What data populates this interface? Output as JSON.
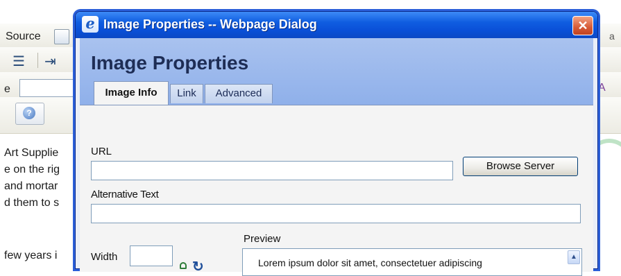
{
  "editor": {
    "source_label": "Source",
    "field_prefix": "e",
    "background_lines": [
      "Art Supplie",
      "e on the rig",
      "and mortar",
      "d them to s",
      "few years i"
    ]
  },
  "dialog": {
    "title": "Image Properties -- Webpage Dialog",
    "heading": "Image Properties",
    "close_glyph": "✕",
    "tabs": [
      {
        "label": "Image Info",
        "active": true
      },
      {
        "label": "Link",
        "active": false
      },
      {
        "label": "Advanced",
        "active": false
      }
    ],
    "url": {
      "label": "URL",
      "value": ""
    },
    "browse_label": "Browse Server",
    "alt_text": {
      "label": "Alternative Text",
      "value": ""
    },
    "width": {
      "label": "Width",
      "value": ""
    },
    "preview": {
      "label": "Preview",
      "text": "Lorem ipsum dolor sit amet, consectetuer adipiscing"
    }
  },
  "icons": {
    "title_icon": "ie-icon",
    "help": "help-icon",
    "lock": "lock-icon",
    "reset": "reset-size-icon"
  },
  "colors": {
    "titlebar": "#0a50d8",
    "header": "#a9c2ef",
    "close": "#d65a36"
  }
}
